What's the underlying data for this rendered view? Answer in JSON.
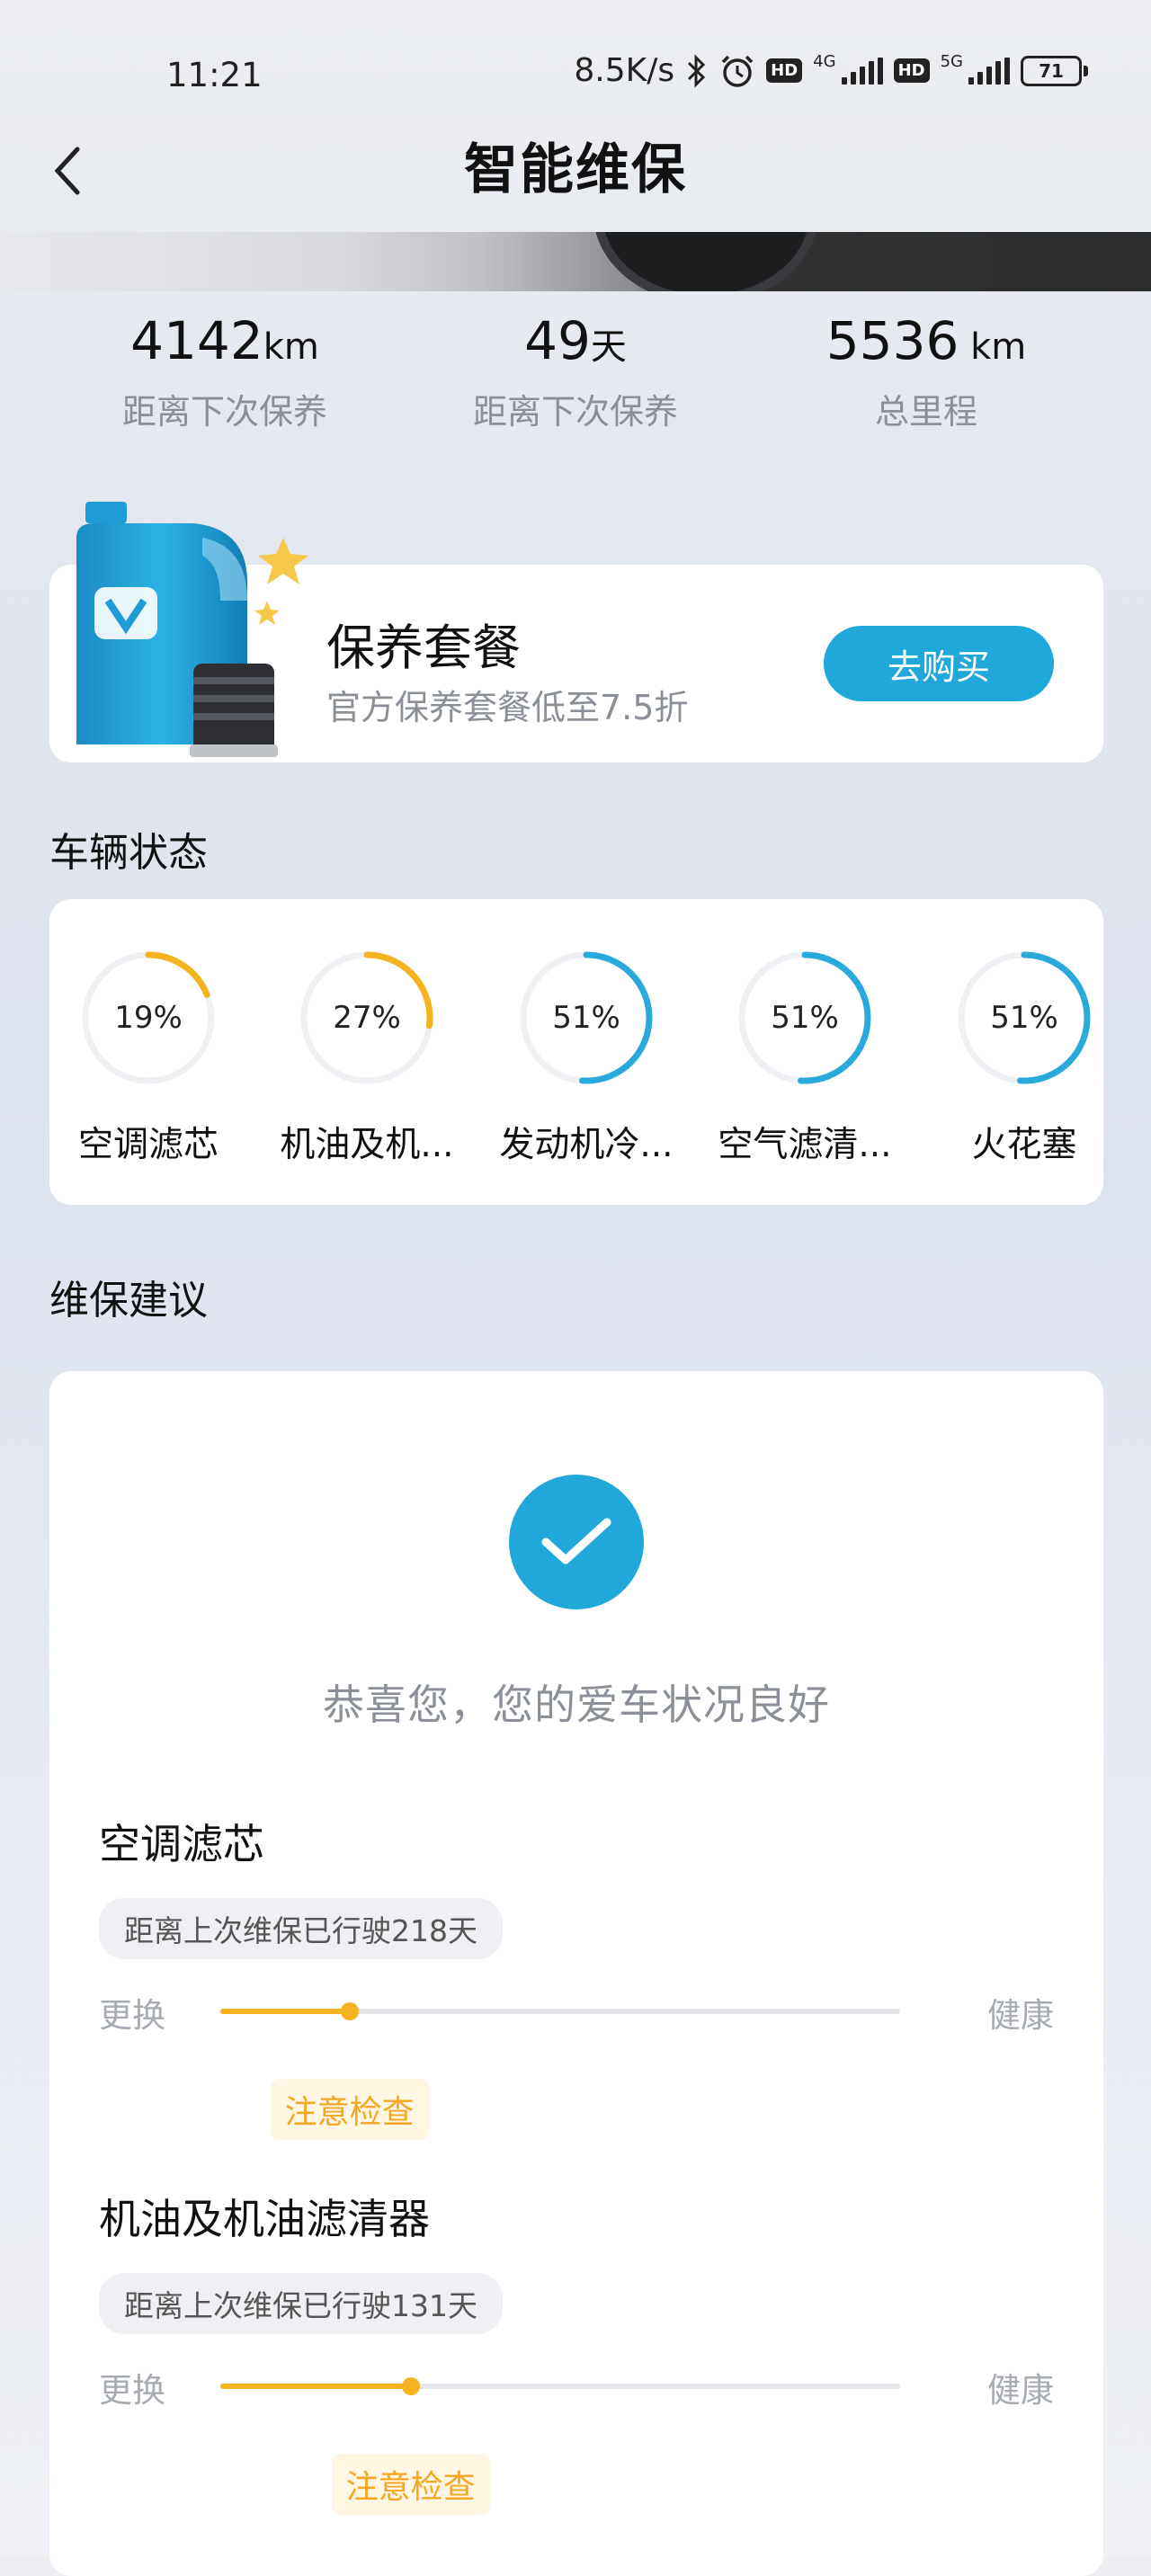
{
  "status_bar": {
    "time": "11:21",
    "net_speed": "8.5K/s",
    "sim1_type": "4G",
    "sim2_type": "5G",
    "hd1": "HD",
    "hd2": "HD",
    "battery": "71"
  },
  "header": {
    "title": "智能维保",
    "back_icon": "chevron-left-icon"
  },
  "stats": [
    {
      "value": "4142",
      "unit": "km",
      "label": "距离下次保养"
    },
    {
      "value": "49",
      "unit": "天",
      "label": "距离下次保养"
    },
    {
      "value": "5536",
      "unit": " km",
      "label": "总里程"
    }
  ],
  "promo": {
    "title": "保养套餐",
    "subtitle": "官方保养套餐低至7.5折",
    "button": "去购买",
    "icon": "oil-bottle-icon"
  },
  "vehicle_status": {
    "title": "车辆状态",
    "gauges": [
      {
        "percent_text": "19%",
        "value": 0.19,
        "label": "空调滤芯",
        "color": "#f5b31f"
      },
      {
        "percent_text": "27%",
        "value": 0.27,
        "label": "机油及机...",
        "color": "#f5b31f"
      },
      {
        "percent_text": "51%",
        "value": 0.51,
        "label": "发动机冷...",
        "color": "#2aa9db"
      },
      {
        "percent_text": "51%",
        "value": 0.51,
        "label": "空气滤清...",
        "color": "#2aa9db"
      },
      {
        "percent_text": "51%",
        "value": 0.51,
        "label": "火花塞",
        "color": "#2aa9db"
      }
    ]
  },
  "advice": {
    "title": "维保建议",
    "congrats": "恭喜您，您的爱车状况良好",
    "check_icon": "checkmark-icon",
    "items": [
      {
        "name": "空调滤芯",
        "pill": "距离上次维保已行驶218天",
        "left": "更换",
        "right": "健康",
        "level": 0.19,
        "warn": "注意检查"
      },
      {
        "name": "机油及机油滤清器",
        "pill": "距离上次维保已行驶131天",
        "left": "更换",
        "right": "健康",
        "level": 0.28,
        "warn": "注意检查"
      }
    ]
  },
  "colors": {
    "accent": "#1fa8d9",
    "warning": "#f5b31f"
  }
}
